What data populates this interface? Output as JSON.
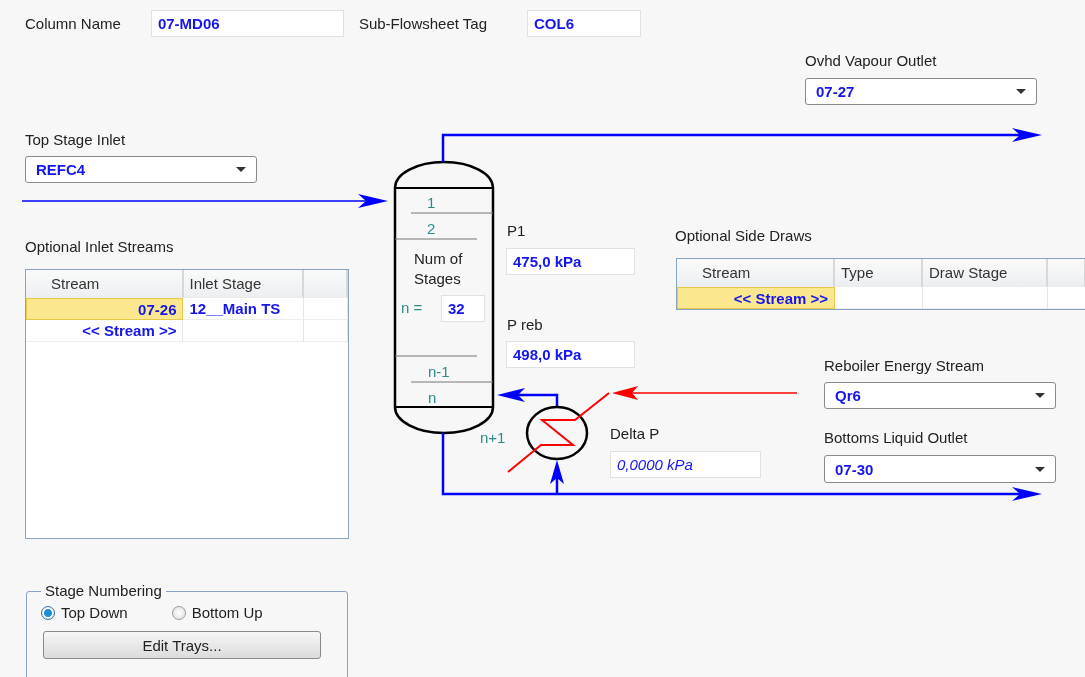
{
  "header": {
    "column_name": {
      "label": "Column Name",
      "value": "07-MD06"
    },
    "subflowsheet_tag": {
      "label": "Sub-Flowsheet Tag",
      "value": "COL6"
    }
  },
  "top_stage_inlet": {
    "label": "Top Stage Inlet",
    "value": "REFC4"
  },
  "inlet_streams": {
    "title": "Optional Inlet Streams",
    "columns": [
      "Stream",
      "Inlet Stage"
    ],
    "rows": [
      {
        "stream": "07-26",
        "inlet_stage": "12__Main TS",
        "selected": true
      },
      {
        "stream": "<< Stream >>",
        "selected": false
      }
    ]
  },
  "stage_numbering": {
    "title": "Stage Numbering",
    "options": [
      {
        "label": "Top Down",
        "selected": true
      },
      {
        "label": "Bottom Up",
        "selected": false
      }
    ],
    "button": "Edit Trays..."
  },
  "ovhd_vapour_outlet": {
    "label": "Ovhd Vapour Outlet",
    "value": "07-27"
  },
  "column": {
    "top_stages": [
      "1",
      "2"
    ],
    "num_stages_label": "Num of Stages",
    "n_label": "n =",
    "n_value": "32",
    "bottom_stages": [
      "n-1",
      "n"
    ],
    "reboiler_stage": "n+1"
  },
  "pressures": [
    {
      "label": "P1",
      "value": "475,0 kPa",
      "kind": "input"
    },
    {
      "label": "P reb",
      "value": "498,0 kPa",
      "kind": "input"
    },
    {
      "label": "Delta P",
      "value": "0,0000 kPa",
      "kind": "calculated"
    }
  ],
  "side_draws": {
    "title": "Optional Side Draws",
    "columns": [
      "Stream",
      "Type",
      "Draw Stage"
    ],
    "rows": [
      {
        "stream": "<< Stream >>",
        "selected": true
      }
    ]
  },
  "reboiler_energy_stream": {
    "label": "Reboiler Energy Stream",
    "value": "Qr6"
  },
  "bottoms_liquid_outlet": {
    "label": "Bottoms Liquid Outlet",
    "value": "07-30"
  }
}
